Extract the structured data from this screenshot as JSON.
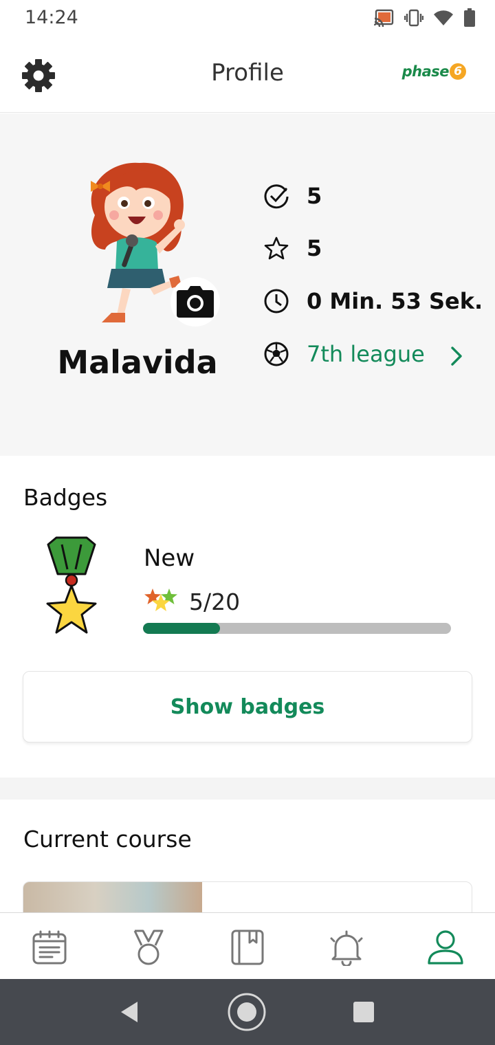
{
  "status_bar": {
    "time": "14:24",
    "icons": [
      "cast-icon",
      "vibrate-icon",
      "wifi-icon",
      "battery-icon"
    ]
  },
  "header": {
    "title": "Profile",
    "logo_text": "phase",
    "logo_number": "6",
    "settings_icon": "gear-icon"
  },
  "profile": {
    "name": "Malavida",
    "stats": [
      {
        "icon": "check-circle-icon",
        "value": "5"
      },
      {
        "icon": "star-outline-icon",
        "value": "5"
      },
      {
        "icon": "clock-icon",
        "value": "0 Min. 53 Sek."
      },
      {
        "icon": "soccer-ball-icon",
        "value": "7th league"
      }
    ]
  },
  "badges": {
    "title": "Badges",
    "level": "New",
    "count": "5/20",
    "progress": 0.25,
    "button_label": "Show badges"
  },
  "course": {
    "title": "Current course"
  },
  "bottom_nav": [
    {
      "name": "tasks",
      "icon": "calendar-list-icon",
      "active": false
    },
    {
      "name": "achievements",
      "icon": "medal-icon",
      "active": false
    },
    {
      "name": "library",
      "icon": "book-icon",
      "active": false
    },
    {
      "name": "notifications",
      "icon": "bell-icon",
      "active": false
    },
    {
      "name": "profile",
      "icon": "user-icon",
      "active": true
    }
  ],
  "colors": {
    "accent": "#138a5a",
    "progress": "#147a52",
    "track": "#bdbdbd",
    "system_nav": "#46494f"
  }
}
